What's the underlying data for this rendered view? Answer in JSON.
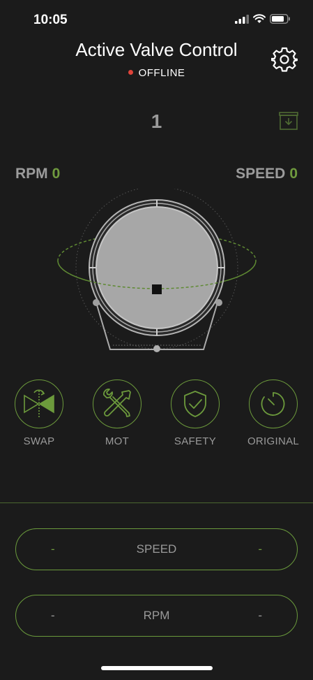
{
  "status_bar": {
    "time": "10:05"
  },
  "header": {
    "title": "Active Valve Control",
    "connection": "OFFLINE"
  },
  "counter": {
    "value": "1"
  },
  "readouts": {
    "rpm_label": "RPM",
    "rpm_value": "0",
    "speed_label": "SPEED",
    "speed_value": "0"
  },
  "modes": [
    {
      "label": "SWAP",
      "icon": "valve-swap-icon"
    },
    {
      "label": "MOT",
      "icon": "tools-icon"
    },
    {
      "label": "SAFETY",
      "icon": "shield-check-icon"
    },
    {
      "label": "ORIGINAL",
      "icon": "stopwatch-icon"
    }
  ],
  "controls": {
    "speed": {
      "label": "SPEED",
      "minus": "-",
      "plus": "-"
    },
    "rpm": {
      "label": "RPM",
      "minus": "-",
      "plus": "-"
    }
  },
  "colors": {
    "accent": "#6c9a3c",
    "background": "#1b1b1b",
    "offline_dot": "#e0443a"
  }
}
